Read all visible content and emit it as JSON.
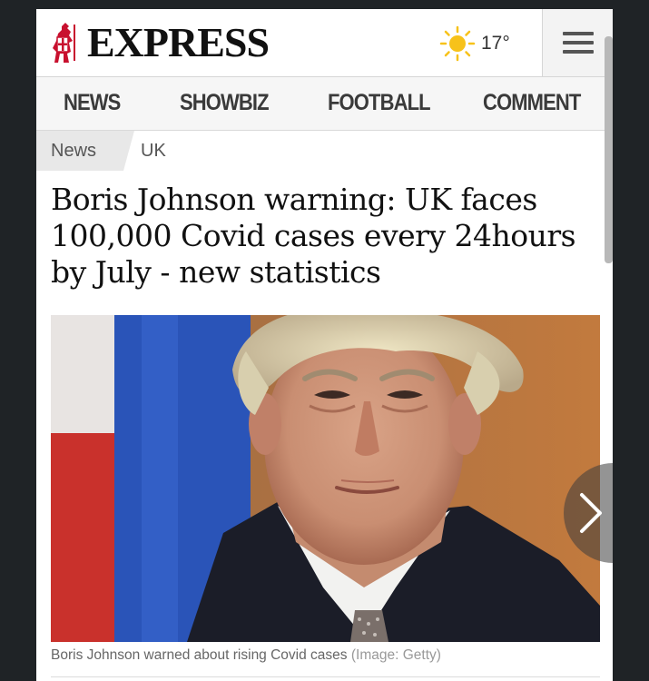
{
  "masthead": {
    "logo_text": "EXPRESS",
    "weather_icon": "sun-icon",
    "temperature": "17°",
    "menu_icon": "hamburger-menu-icon"
  },
  "nav": {
    "items": [
      {
        "label": "NEWS"
      },
      {
        "label": "SHOWBIZ"
      },
      {
        "label": "FOOTBALL"
      },
      {
        "label": "COMMENT"
      }
    ]
  },
  "breadcrumb": {
    "items": [
      {
        "label": "News"
      },
      {
        "label": "UK"
      }
    ]
  },
  "article": {
    "headline": "Boris Johnson warning: UK faces 100,000 Covid cases every 24hours by July - new statistics",
    "caption": "Boris Johnson warned about rising Covid cases",
    "credit": "(Image: Getty)"
  },
  "carousel": {
    "next_icon": "chevron-right-icon"
  },
  "colors": {
    "page_bg": "#ffffff",
    "outer_bg": "#1f2326",
    "nav_bg": "#f6f6f6",
    "logo_red": "#c8102e",
    "sun_yellow": "#f7c21a"
  }
}
